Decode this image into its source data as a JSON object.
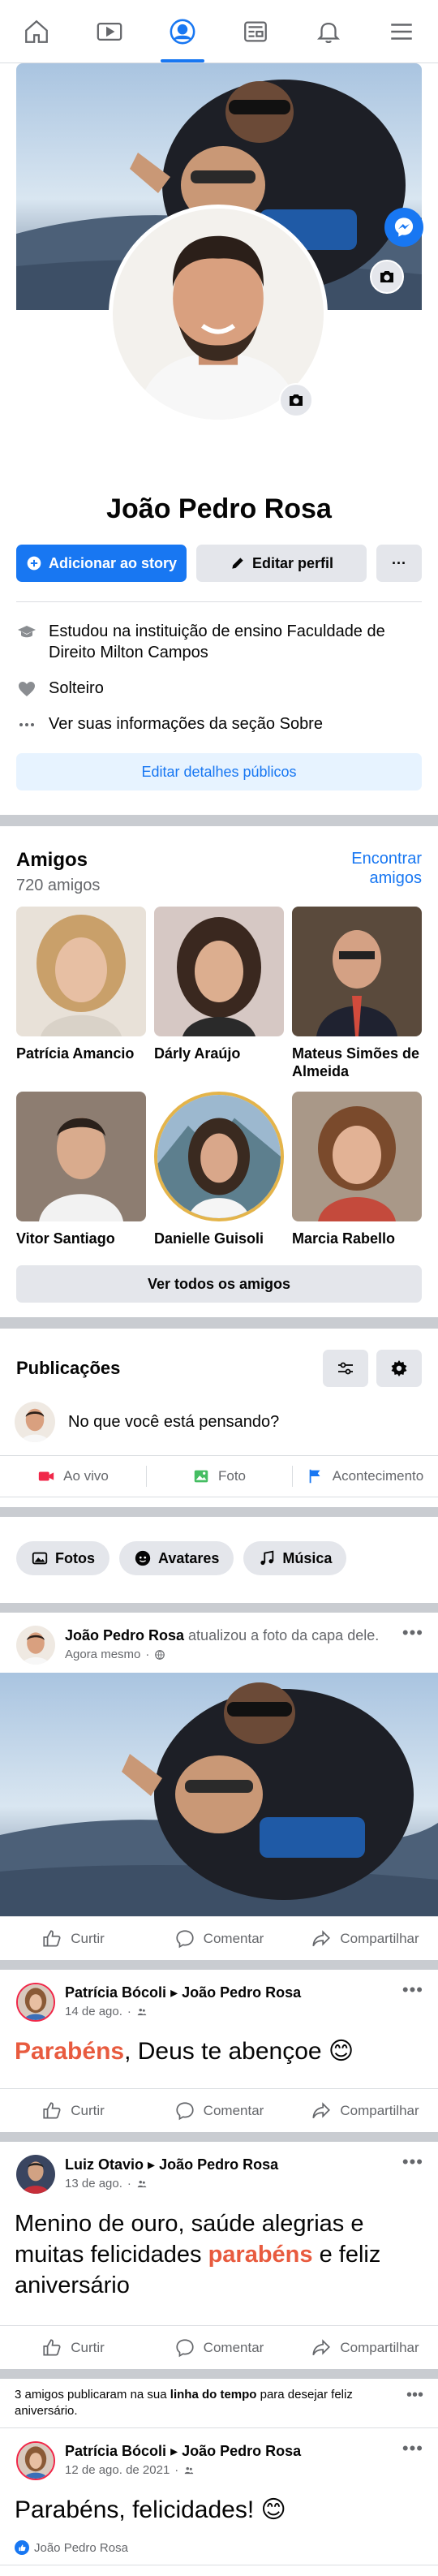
{
  "nav": {
    "items": [
      "home-icon",
      "video-icon",
      "profile-icon",
      "news-icon",
      "bell-icon",
      "menu-icon"
    ],
    "active_index": 2
  },
  "profile": {
    "name": "João Pedro Rosa",
    "add_story_label": "Adicionar ao story",
    "edit_profile_label": "Editar perfil",
    "more_label": "···"
  },
  "info": {
    "education": "Estudou na instituição de ensino Faculdade de Direito Milton Campos",
    "relationship": "Solteiro",
    "about": "Ver suas informações da seção Sobre",
    "edit_public_label": "Editar detalhes públicos"
  },
  "friends": {
    "title": "Amigos",
    "count": "720 amigos",
    "find_label": "Encontrar amigos",
    "list": [
      {
        "name": "Patrícia Amancio"
      },
      {
        "name": "Dárly Araújo"
      },
      {
        "name": "Mateus Simões de Almeida"
      },
      {
        "name": "Vitor Santiago"
      },
      {
        "name": "Danielle Guisoli"
      },
      {
        "name": "Marcia Rabello"
      }
    ],
    "see_all_label": "Ver todos os amigos"
  },
  "publications": {
    "title": "Publicações",
    "composer_placeholder": "No que você está pensando?",
    "live_label": "Ao vivo",
    "photo_label": "Foto",
    "event_label": "Acontecimento"
  },
  "chips": {
    "photos": "Fotos",
    "avatars": "Avatares",
    "music": "Música"
  },
  "post_actions": {
    "like": "Curtir",
    "comment": "Comentar",
    "share": "Compartilhar"
  },
  "posts": [
    {
      "author": "João Pedro Rosa",
      "action": " atualizou a foto da capa dele.",
      "time": "Agora mesmo"
    },
    {
      "author": "Patrícia Bócoli",
      "arrow": "▸",
      "target": "João Pedro Rosa",
      "time": "14 de ago.",
      "text_highlight": "Parabéns",
      "text_rest": ", Deus te abençoe 😊"
    },
    {
      "author": "Luiz Otavio",
      "arrow": "▸",
      "target": "João Pedro Rosa",
      "time": "13 de ago.",
      "text_before": "Menino de ouro, saúde alegrias e muitas felicidades ",
      "text_highlight": "parabéns",
      "text_after": " e feliz aniversário"
    },
    {
      "author": "Patrícia Bócoli",
      "arrow": "▸",
      "target": "João Pedro Rosa",
      "time": "12 de ago. de 2021",
      "text": "Parabéns, felicidades! 😊",
      "reaction_name": "João Pedro Rosa"
    }
  ],
  "timeline_notice": {
    "before": "3 amigos publicaram na sua ",
    "bold": "linha do tempo",
    "after": " para desejar feliz aniversário."
  },
  "colors": {
    "accent": "#1877f2",
    "highlight": "#e85b3f",
    "divider": "#c9ccd1"
  }
}
